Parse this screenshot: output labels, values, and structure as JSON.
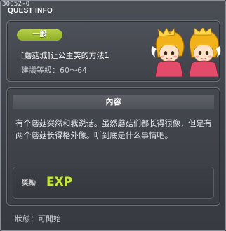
{
  "window": {
    "quest_id": "30052-0",
    "title": "QUEST INFO"
  },
  "header": {
    "category": "一般",
    "quest_name": "[蘑菇城]让公主笑的方法1",
    "level_label": "建議等級：",
    "level_range": "60～64",
    "portrait_icon": "twin-princess-portrait-icon"
  },
  "content": {
    "heading": "內容",
    "text": "有个蘑菇突然和我说话。虽然蘑菇们都长得很像，但是有两个蘑菇长得格外像。听到底是什么事情吧。"
  },
  "reward": {
    "label": "獎勵",
    "exp_text": "EXP",
    "exp_icon": "exp-icon"
  },
  "status": {
    "label": "狀態：",
    "value": "可開始"
  },
  "colors": {
    "category_green": "#9fbf33",
    "exp_green": "#c8e63a"
  }
}
